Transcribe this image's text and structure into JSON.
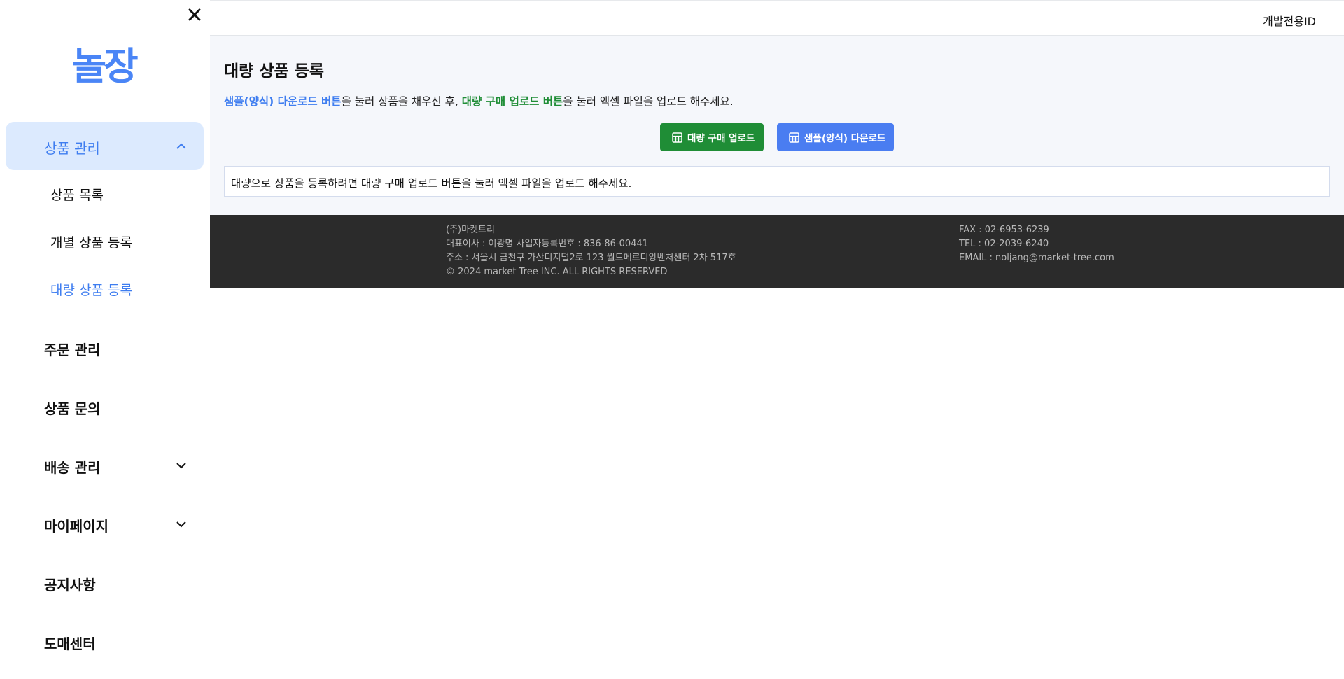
{
  "sidebar": {
    "logo_text": "놀장",
    "expanded_menu": {
      "label": "상품 관리"
    },
    "sub_items": [
      {
        "label": "상품 목록"
      },
      {
        "label": "개별 상품 등록"
      },
      {
        "label": "대량 상품 등록"
      }
    ],
    "menu_items": [
      {
        "label": "주문 관리"
      },
      {
        "label": "상품 문의"
      },
      {
        "label": "배송 관리"
      },
      {
        "label": "마이페이지"
      },
      {
        "label": "공지사항"
      },
      {
        "label": "도매센터"
      }
    ]
  },
  "header": {
    "user_id": "개발전용ID"
  },
  "main": {
    "title": "대량 상품 등록",
    "instruction": {
      "part1": "샘플(양식) 다운로드 버튼",
      "part2": "을 눌러 상품을 채우신 후, ",
      "part3": "대량 구매 업로드 버튼",
      "part4": "을 눌러 엑셀 파일을 업로드 해주세요."
    },
    "upload_button": "대량 구매 업로드",
    "download_button": "샘플(양식) 다운로드",
    "notice": "대량으로 상품을 등록하려면 대량 구매 업로드 버튼을 눌러 엑셀 파일을 업로드 해주세요."
  },
  "footer": {
    "company": "(주)마켓트리",
    "ceo_line": "대표이사 : 이광명 사업자등록번호 : 836-86-00441",
    "address": "주소 : 서울시 금천구 가산디지털2로 123 월드메르디앙벤처센터 2차 517호",
    "copyright": "© 2024 market Tree INC. ALL RIGHTS RESERVED",
    "fax": "FAX : 02-6953-6239",
    "tel": "TEL : 02-2039-6240",
    "email": "EMAIL : noljang@market-tree.com"
  },
  "colors": {
    "accent_blue": "#3e7df0",
    "accent_green": "#1f8d36",
    "footer_bg": "#2b2b2b"
  },
  "icons": [
    "close-icon",
    "chevron-up-icon",
    "chevron-down-icon",
    "table-icon"
  ]
}
